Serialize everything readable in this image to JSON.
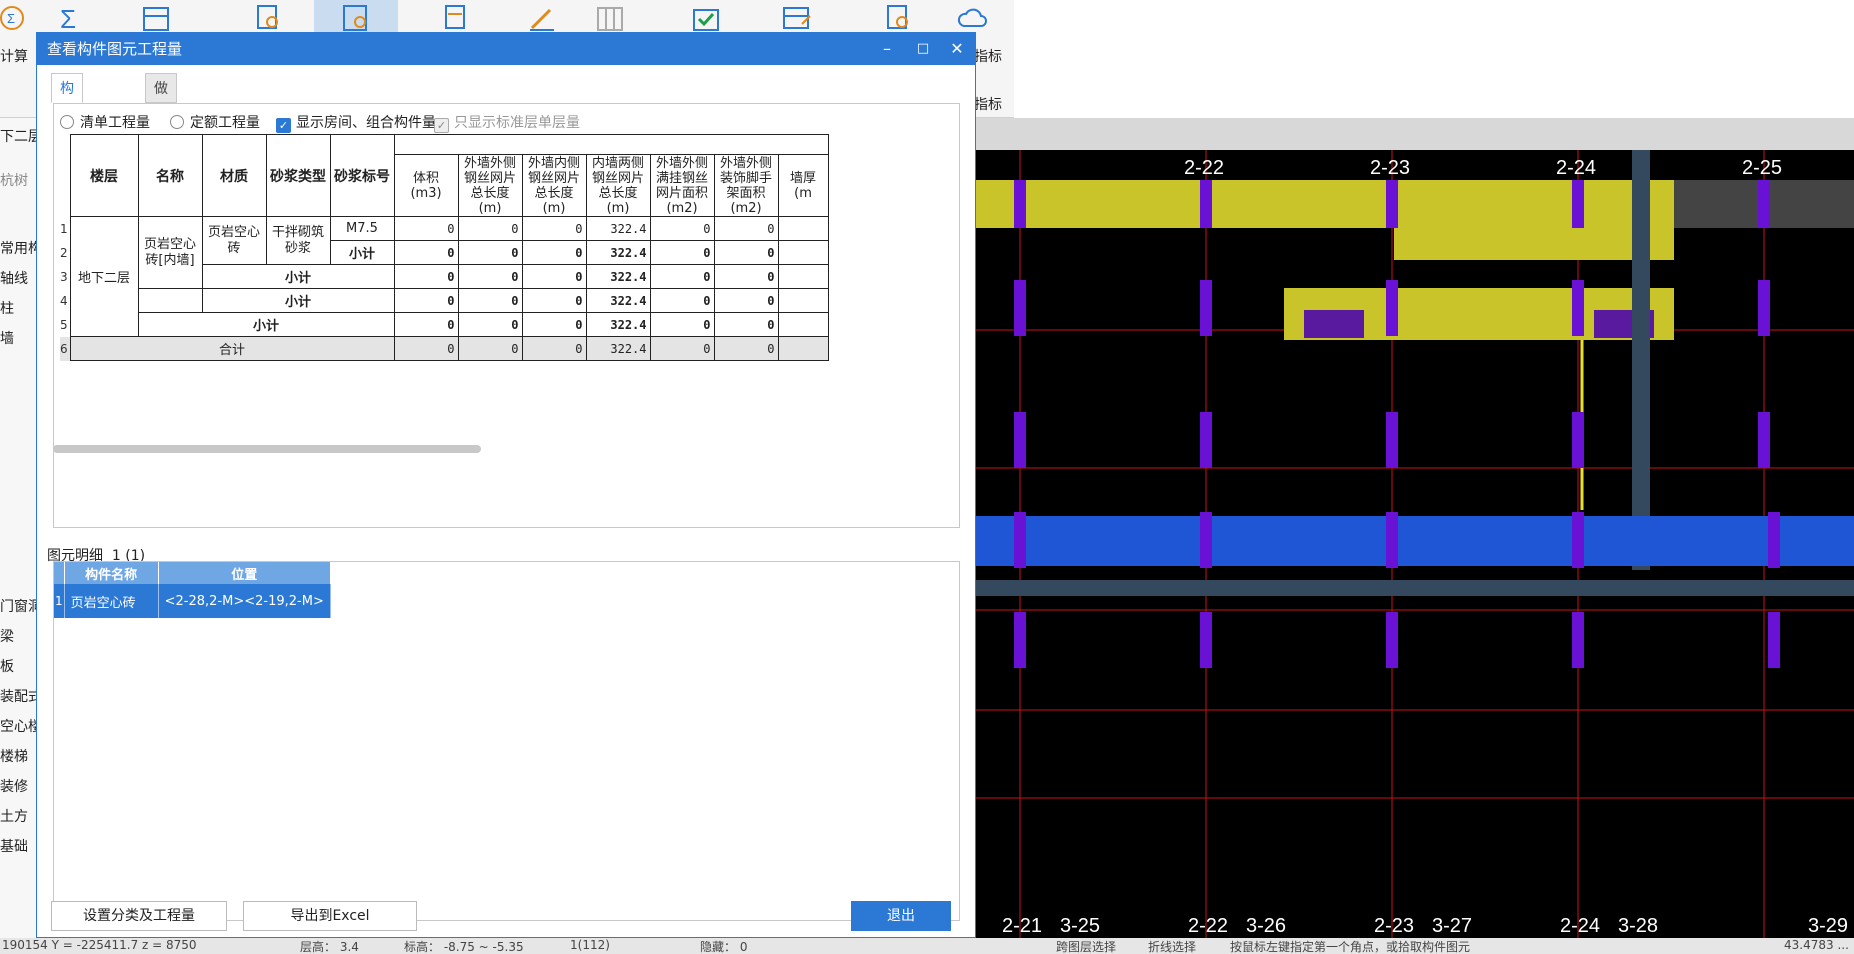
{
  "app": {
    "ribbon_labels": [
      "计算",
      "指标",
      "指标"
    ],
    "left_panel_items": [
      "下二层",
      "杭树",
      "常用构",
      "轴线",
      "柱",
      "墙",
      "门窗洞",
      "梁",
      "板",
      "装配式",
      "空心楼",
      "楼梯",
      "装修",
      "土方",
      "基础"
    ]
  },
  "dialog": {
    "title": "查看构件图元工程量",
    "tabs": [
      "构件工程量",
      "做法工程量"
    ],
    "options": {
      "radio_list": "清单工程量",
      "radio_quota": "定额工程量",
      "check_show_rooms": "显示房间、组合构件量",
      "check_std_floor": "只显示标准层单层量"
    },
    "table": {
      "headers": {
        "floor": "楼层",
        "name": "名称",
        "material": "材质",
        "mortar_type": "砂浆类型",
        "mortar_grade": "砂浆标号",
        "volume": "体积(m3)",
        "ext_outer_mesh": "外墙外侧钢丝网片总长度(m)",
        "ext_inner_mesh": "外墙内侧钢丝网片总长度(m)",
        "int_both_mesh": "内墙两侧钢丝网片总长度(m)",
        "ext_full_mesh_area": "外墙外侧满挂钢丝网片面积(m2)",
        "ext_scaffold_area": "外墙外侧装饰脚手架面积(m2)",
        "thickness": "墙厚(m"
      },
      "row_numbers": [
        "1",
        "2",
        "3",
        "4",
        "5",
        "6"
      ],
      "floor_value": "地下二层",
      "name_value": "页岩空心砖[内墙]",
      "material_value": "页岩空心砖",
      "mortar_type_value": "干拌砌筑砂浆",
      "mortar_grade_value": "M7.5",
      "subtotal_label": "小计",
      "total_label": "合计",
      "rows": [
        [
          "0",
          "0",
          "0",
          "322.4",
          "0",
          "0"
        ],
        [
          "0",
          "0",
          "0",
          "322.4",
          "0",
          "0"
        ],
        [
          "0",
          "0",
          "0",
          "322.4",
          "0",
          "0"
        ],
        [
          "0",
          "0",
          "0",
          "322.4",
          "0",
          "0"
        ],
        [
          "0",
          "0",
          "0",
          "322.4",
          "0",
          "0"
        ],
        [
          "0",
          "0",
          "0",
          "322.4",
          "0",
          "0"
        ]
      ]
    },
    "detail": {
      "label": "图元明细",
      "count": "1 (1)",
      "headers": [
        "构件名称",
        "位置"
      ],
      "row_number": "1",
      "row": [
        "页岩空心砖",
        "<2-28,2-M><2-19,2-M>"
      ]
    },
    "buttons": {
      "settings": "设置分类及工程量",
      "export": "导出到Excel",
      "exit": "退出"
    }
  },
  "canvas": {
    "top_axis": [
      "2-22",
      "2-23",
      "2-24",
      "2-25"
    ],
    "bottom_axis": [
      "2-21",
      "3-25",
      "2-22",
      "3-26",
      "2-23",
      "3-27",
      "2-24",
      "3-28",
      "3-29"
    ]
  },
  "statusbar": {
    "coords": "190154  Y = -225411.7  z = 8750",
    "floor_height": "层高：  3.4",
    "elevation": "标高：  -8.75 ~ -5.35",
    "selection": "1(112)",
    "hidden": "隐藏：  0",
    "cross_layer": "跨图层选择",
    "polyline": "折线选择",
    "hint": "按鼠标左键指定第一个角点，或拾取构件图元",
    "right_value": "43.4783 ..."
  },
  "colors": {
    "accent": "#2b79d4",
    "wall_yellow": "#c8c42a",
    "wall_blue": "#1f56d6",
    "column_purple": "#6a11d6",
    "grid_red": "#c81414"
  }
}
